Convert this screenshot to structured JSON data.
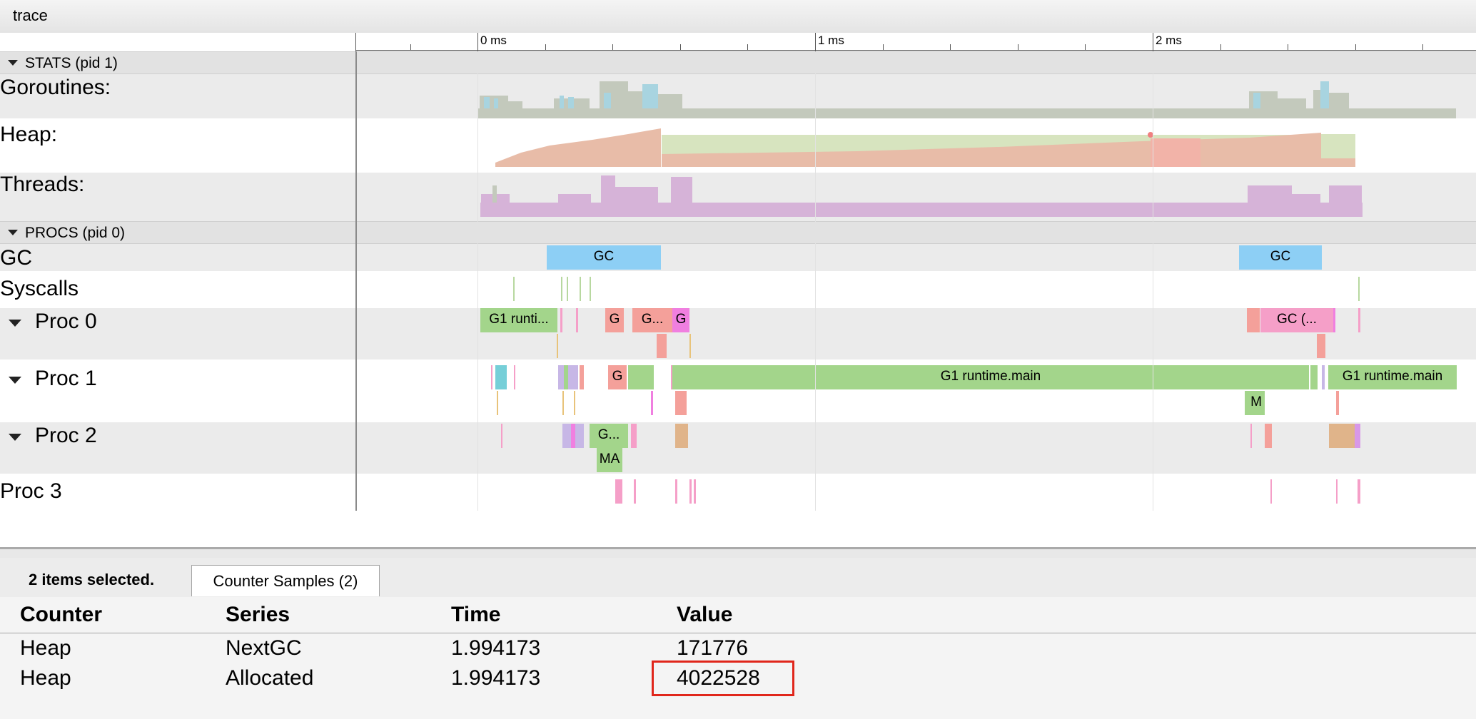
{
  "window": {
    "title": "trace"
  },
  "ruler": {
    "labels": [
      "0 ms",
      "1 ms",
      "2 ms"
    ]
  },
  "stats_group": {
    "label": "STATS (pid 1)",
    "tracks": [
      "Goroutines:",
      "Heap:",
      "Threads:"
    ]
  },
  "procs_group": {
    "label": "PROCS (pid 0)",
    "tracks": {
      "gc": "GC",
      "syscalls": "Syscalls",
      "proc0": "Proc 0",
      "proc1": "Proc 1",
      "proc2": "Proc 2",
      "proc3": "Proc 3"
    }
  },
  "slices": {
    "gc_a": "GC",
    "gc_b": "GC",
    "p0_g1": "G1 runti...",
    "p0_g": "G",
    "p0_gdots": "G...",
    "p0_g2": "G",
    "p0_gc": "GC (...",
    "p1_g": "G",
    "p1_main": "G1 runtime.main",
    "p1_main2": "G1 runtime.main",
    "p1_m": "M",
    "p2_gdots": "G...",
    "p2_ma": "MA"
  },
  "colors": {
    "goroutines_runnable": "#a8d4e0",
    "goroutines_running": "#c3c9bc",
    "heap_allocated": "#e8bca8",
    "heap_nextgc": "#d7e4bf",
    "threads": "#d6b3d8",
    "gc": "#8dcff5",
    "goroutine_green": "#a3d58b",
    "goroutine_salmon": "#f4a09a",
    "goroutine_pink": "#f59fc8",
    "selection_box": "#e0261b"
  },
  "details": {
    "selection_summary": "2 items selected.",
    "tab_label": "Counter Samples (2)",
    "columns": [
      "Counter",
      "Series",
      "Time",
      "Value"
    ],
    "rows": [
      [
        "Heap",
        "NextGC",
        "1.994173",
        "171776"
      ],
      [
        "Heap",
        "Allocated",
        "1.994173",
        "4022528"
      ]
    ]
  }
}
